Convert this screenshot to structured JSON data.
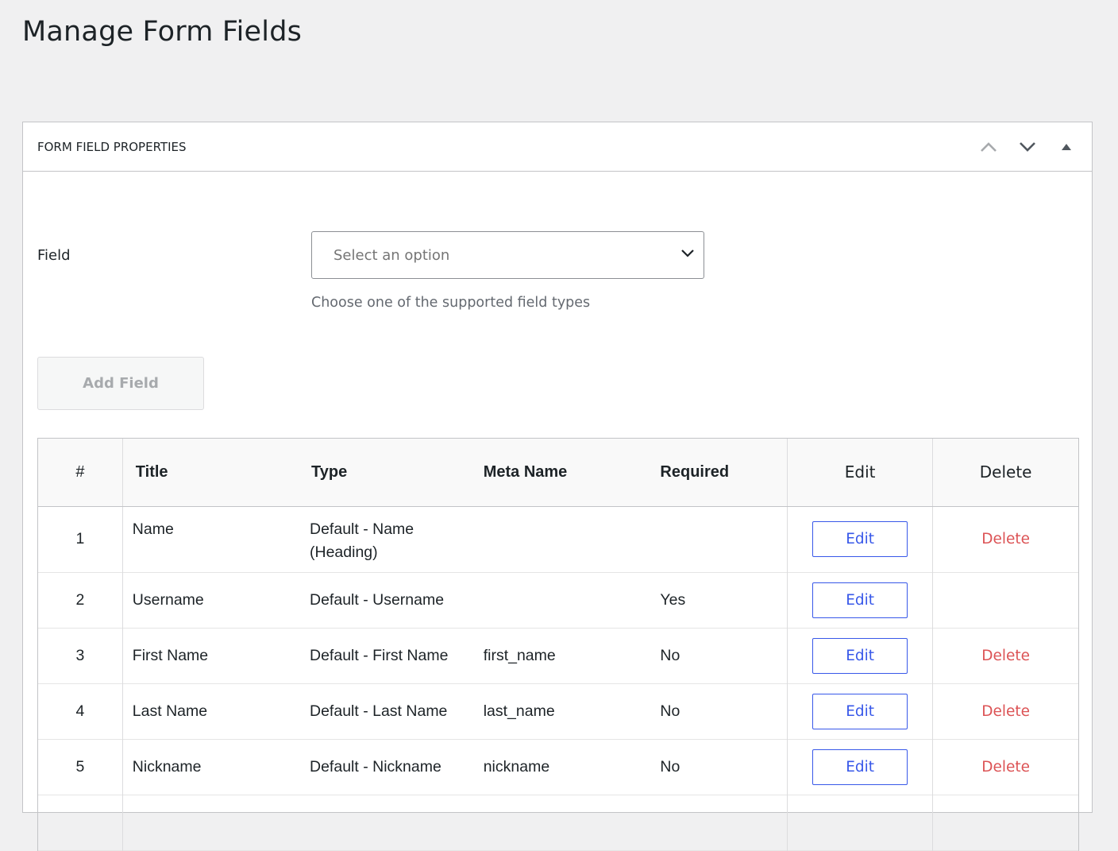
{
  "page": {
    "title": "Manage Form Fields"
  },
  "postbox": {
    "title": "FORM FIELD PROPERTIES",
    "actions": [
      "chevron-up-icon",
      "chevron-down-icon",
      "triangle-up-icon"
    ]
  },
  "field": {
    "label": "Field",
    "select_placeholder": "Select an option",
    "help_text": "Choose one of the supported field types"
  },
  "add_field_button": "Add Field",
  "table": {
    "headers": {
      "num": "#",
      "title": "Title",
      "type": "Type",
      "meta_name": "Meta Name",
      "required": "Required",
      "edit": "Edit",
      "delete": "Delete"
    },
    "rows": [
      {
        "num": "1",
        "title": "Name",
        "type": "Default - Name (Heading)",
        "meta_name": "",
        "required": "",
        "edit": "Edit",
        "delete": "Delete"
      },
      {
        "num": "2",
        "title": "Username",
        "type": "Default - Username",
        "meta_name": "",
        "required": "Yes",
        "edit": "Edit",
        "delete": ""
      },
      {
        "num": "3",
        "title": "First Name",
        "type": "Default - First Name",
        "meta_name": "first_name",
        "required": "No",
        "edit": "Edit",
        "delete": "Delete"
      },
      {
        "num": "4",
        "title": "Last Name",
        "type": "Default - Last Name",
        "meta_name": "last_name",
        "required": "No",
        "edit": "Edit",
        "delete": "Delete"
      },
      {
        "num": "5",
        "title": "Nickname",
        "type": "Default - Nickname",
        "meta_name": "nickname",
        "required": "No",
        "edit": "Edit",
        "delete": "Delete"
      }
    ]
  },
  "colors": {
    "accent": "#3858e9",
    "danger": "#d63638",
    "background": "#f0f0f1"
  }
}
